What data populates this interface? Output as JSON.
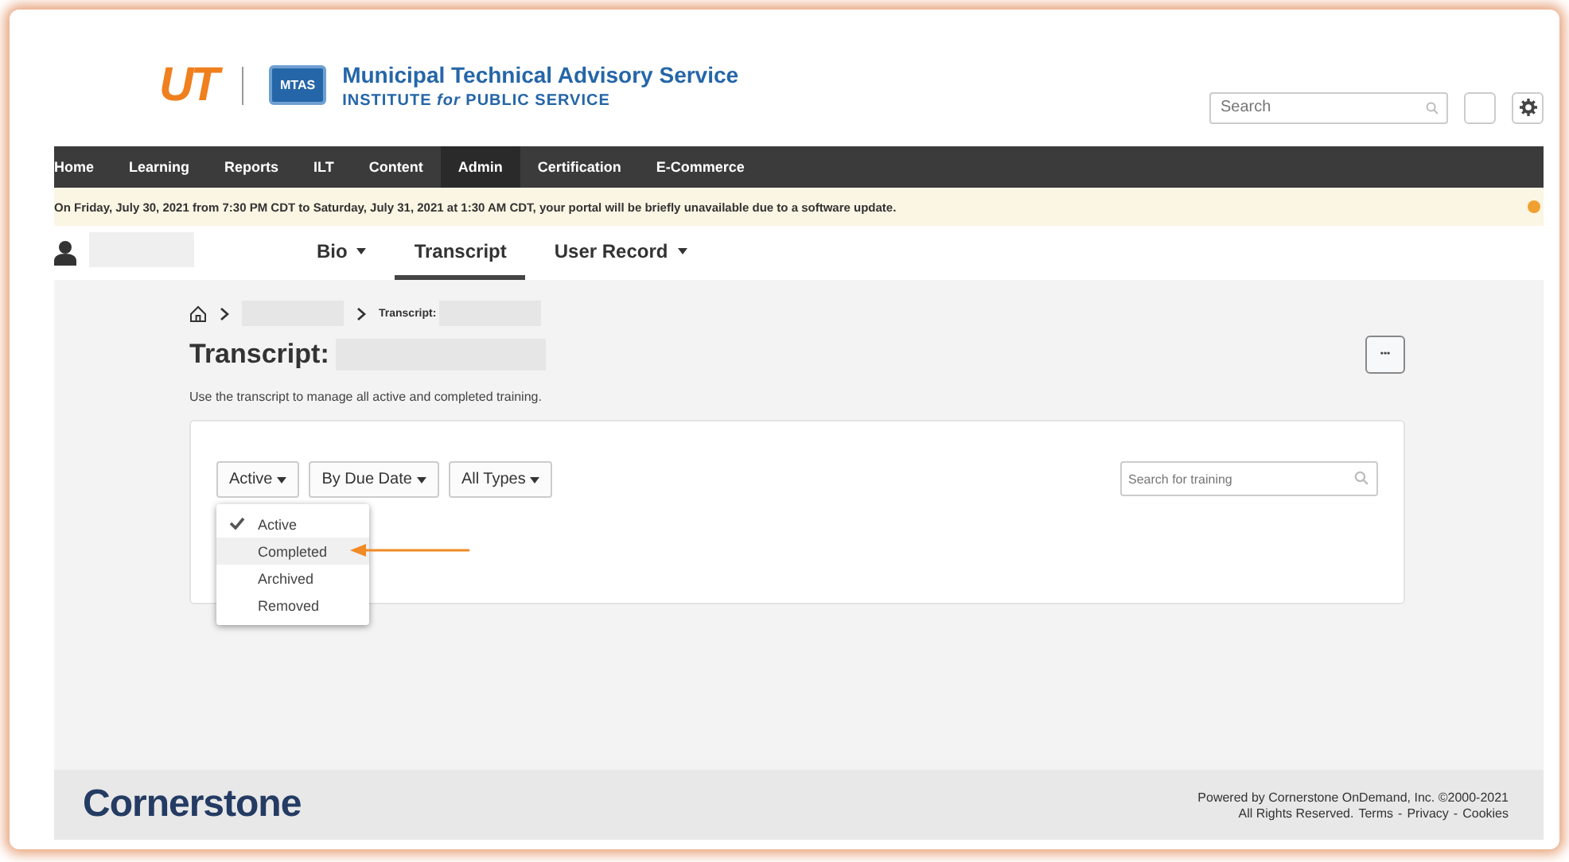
{
  "header": {
    "ut_logo": "UT",
    "badge": "MTAS",
    "org_title": "Municipal Technical Advisory Service",
    "org_subtitle": "INSTITUTE *for* PUBLIC SERVICE",
    "search": {
      "placeholder": "Search"
    }
  },
  "nav": [
    {
      "label": "Home",
      "selected": false
    },
    {
      "label": "Learning",
      "selected": false
    },
    {
      "label": "Reports",
      "selected": false
    },
    {
      "label": "ILT",
      "selected": false
    },
    {
      "label": "Content",
      "selected": false
    },
    {
      "label": "Admin",
      "selected": true
    },
    {
      "label": "Certification",
      "selected": false
    },
    {
      "label": "E-Commerce",
      "selected": false
    }
  ],
  "notice": "On Friday, July 30, 2021 from 7:30 PM CDT to Saturday, July 31, 2021 at 1:30 AM CDT, your portal will be briefly unavailable due to a software update.",
  "profile_tabs": [
    {
      "label": "Bio",
      "selected": false,
      "caret": true
    },
    {
      "label": "Transcript",
      "selected": true,
      "caret": false
    },
    {
      "label": "User Record",
      "selected": false,
      "caret": true
    }
  ],
  "breadcrumb": {
    "current": "Transcript:"
  },
  "title": "Transcript:",
  "more_button": "•••",
  "description": "Use the transcript to manage all active and completed training.",
  "filters": [
    "Active",
    "By Due Date",
    "All Types"
  ],
  "status_menu": [
    {
      "label": "Active",
      "checked": true,
      "highlighted": false
    },
    {
      "label": "Completed",
      "checked": false,
      "highlighted": true
    },
    {
      "label": "Archived",
      "checked": false,
      "highlighted": false
    },
    {
      "label": "Removed",
      "checked": false,
      "highlighted": false
    }
  ],
  "training_search": {
    "placeholder": "Search for training"
  },
  "footer": {
    "logo": "Cornerstone",
    "line1": "Powered by Cornerstone OnDemand, Inc. ©2000-2021",
    "line2": "All Rights Reserved.",
    "links": [
      "Terms",
      "Privacy",
      "Cookies"
    ],
    "separator": "-"
  }
}
